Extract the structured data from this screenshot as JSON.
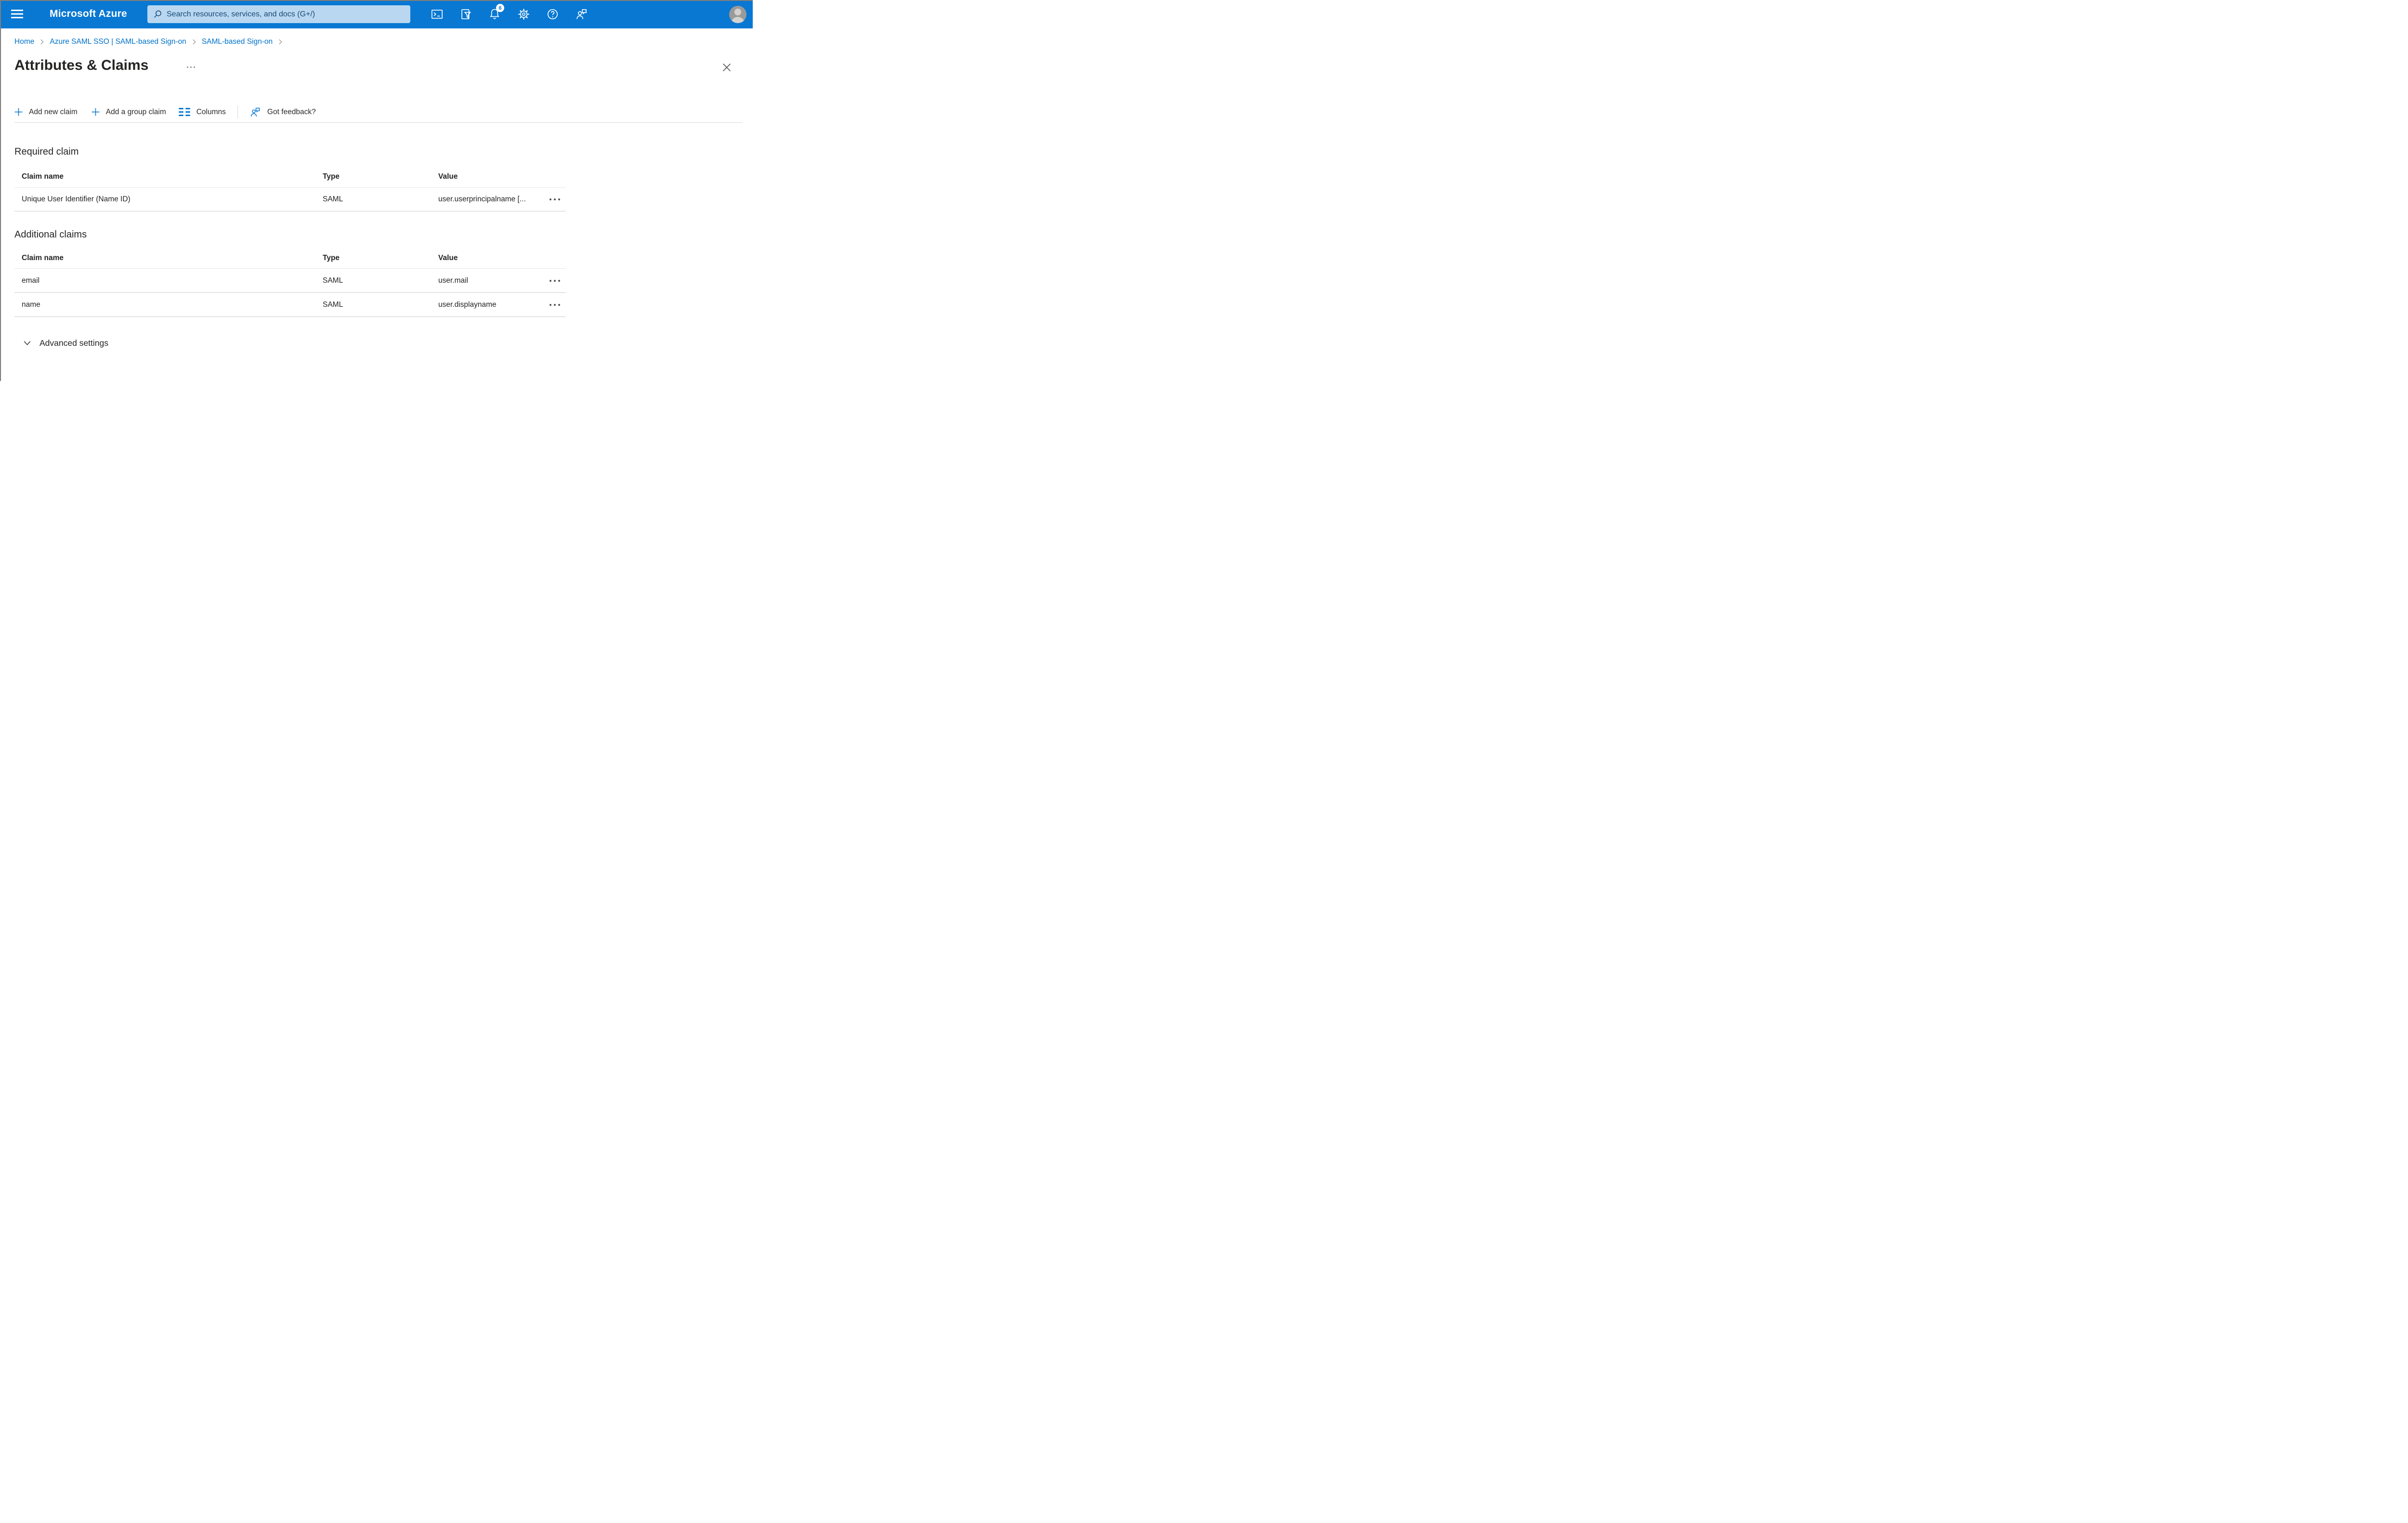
{
  "header": {
    "brand": "Microsoft Azure",
    "search_placeholder": "Search resources, services, and docs (G+/)",
    "notification_count": "6",
    "icons": {
      "hamburger": "menu-lines",
      "search": "magnifier",
      "cloud_shell": ">_ terminal",
      "directory_filter": "document-funnel",
      "notifications": "bell",
      "settings": "gear",
      "help": "question-circle",
      "feedback": "person-speech-bubble",
      "avatar": "person-silhouette"
    }
  },
  "breadcrumb": {
    "items": [
      {
        "label": "Home"
      },
      {
        "label": "Azure SAML SSO | SAML-based Sign-on"
      },
      {
        "label": "SAML-based Sign-on"
      }
    ],
    "separator": ">"
  },
  "page": {
    "title": "Attributes & Claims",
    "overflow_menu_icon": "ellipsis-dots",
    "close_icon": "x"
  },
  "toolbar": {
    "items": [
      {
        "label": "Add new claim",
        "icon": "plus"
      },
      {
        "label": "Add a group claim",
        "icon": "plus"
      },
      {
        "label": "Columns",
        "icon": "column-lines"
      },
      {
        "label": "Got feedback?",
        "icon": "person-speech-bubble"
      }
    ]
  },
  "required_claim": {
    "heading": "Required claim",
    "columns": [
      "Claim name",
      "Type",
      "Value"
    ],
    "rows": [
      {
        "claim_name": "Unique User Identifier (Name ID)",
        "type": "SAML",
        "value": "user.userprincipalname [...",
        "menu_icon": "ellipsis-dots"
      }
    ]
  },
  "additional_claims": {
    "heading": "Additional claims",
    "columns": [
      "Claim name",
      "Type",
      "Value"
    ],
    "rows": [
      {
        "claim_name": "email",
        "type": "SAML",
        "value": "user.mail",
        "menu_icon": "ellipsis-dots"
      },
      {
        "claim_name": "name",
        "type": "SAML",
        "value": "user.displayname",
        "menu_icon": "ellipsis-dots"
      }
    ]
  },
  "advanced": {
    "label": "Advanced settings",
    "chevron_icon": "chevron-down"
  },
  "colors": {
    "topbar_blue": "#0878d3",
    "search_field_bg": "#b9d7f0",
    "search_field_text": "#174a77",
    "breadcrumb_link": "#0072c9",
    "toolbar_icon_blue": "#0878d3",
    "text_primary": "#252423",
    "divider_light": "#e8e7e5",
    "divider_medium": "#d0cecc",
    "badge_bg": "#ffffff",
    "badge_text": "#0878d3"
  }
}
